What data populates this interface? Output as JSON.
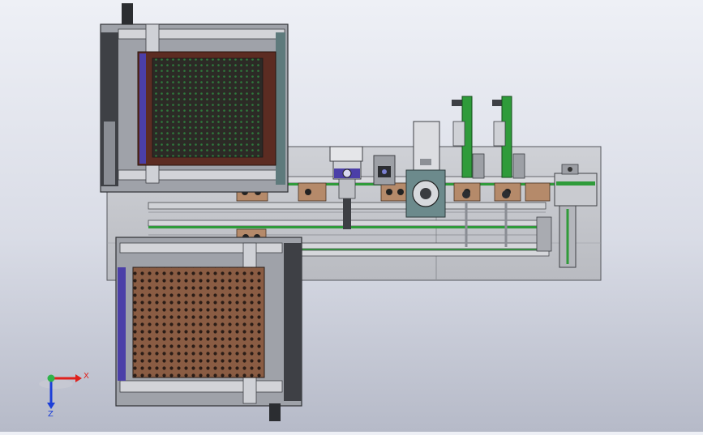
{
  "view": {
    "background_top": "#eef0f6",
    "background_bottom": "#b6bac8"
  },
  "triad": {
    "x_label": "X",
    "z_label": "Z",
    "x_color": "#e0201c",
    "y_color": "#2fb34a",
    "z_color": "#1c3fd8"
  },
  "colors": {
    "base_plate": "#c5c7cd",
    "frame": "#6d7077",
    "frame_dark": "#3e4045",
    "tray_wood_dark": "#5c2c22",
    "tray_wood_light": "#8a5c43",
    "conveyor_green": "#2f9b3a",
    "motor_purple": "#4b3fa8",
    "bracket_copper": "#b58a6a"
  }
}
